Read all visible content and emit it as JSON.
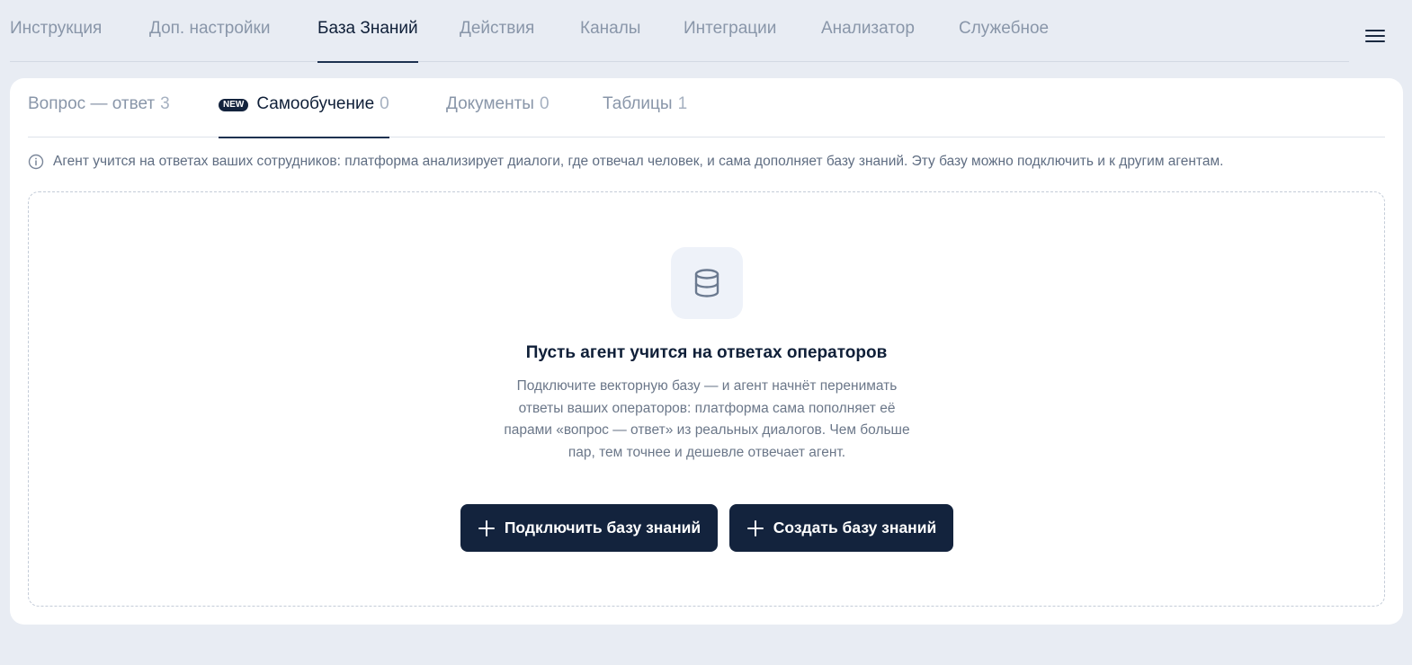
{
  "top_tabs": [
    {
      "label": "Инструкция",
      "active": false
    },
    {
      "label": "Доп. настройки",
      "active": false
    },
    {
      "label": "База Знаний",
      "active": true
    },
    {
      "label": "Действия",
      "active": false
    },
    {
      "label": "Каналы",
      "active": false
    },
    {
      "label": "Интеграции",
      "active": false
    },
    {
      "label": "Анализатор",
      "active": false
    },
    {
      "label": "Служебное",
      "active": false
    }
  ],
  "menu_icon": "hamburger-icon",
  "sub_tabs": [
    {
      "label": "Вопрос — ответ",
      "count": "3",
      "active": false
    },
    {
      "label": "Самообучение",
      "count": "0",
      "active": true,
      "badge": "NEW"
    },
    {
      "label": "Документы",
      "count": "0",
      "active": false
    },
    {
      "label": "Таблицы",
      "count": "1",
      "active": false
    }
  ],
  "info_text": "Агент учится на ответах ваших сотрудников: платформа анализирует диалоги, где отвечал человек, и сама дополняет базу знаний. Эту базу можно подключить и к другим агентам.",
  "empty_state": {
    "icon": "database-icon",
    "title": "Пусть агент учится на ответах операторов",
    "description": "Подключите векторную базу — и агент начнёт перенимать ответы ваших операторов: платформа сама пополняет её парами «вопрос — ответ» из реальных диалогов. Чем больше пар, тем точнее и дешевле отвечает агент.",
    "connect_button": "Подключить базу знаний",
    "create_button": "Создать базу знаний"
  },
  "colors": {
    "page_bg": "#e8ecf3",
    "primary": "#13233d",
    "muted_text": "#8996a9"
  }
}
